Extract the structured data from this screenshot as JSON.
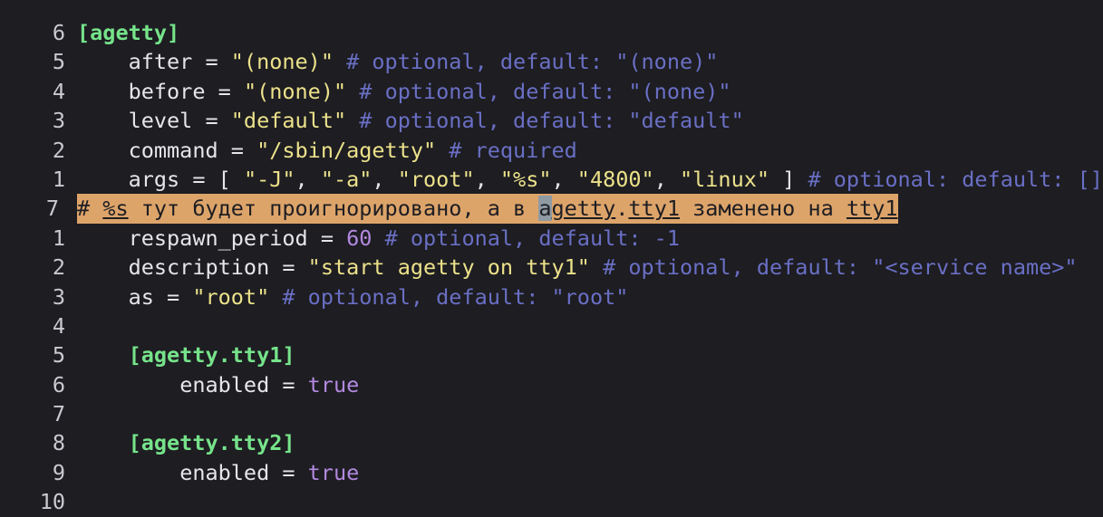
{
  "lines": [
    {
      "num": "6",
      "parts": [
        {
          "t": "sec",
          "v": "[agetty]"
        }
      ]
    },
    {
      "num": "5",
      "indent": "    ",
      "parts": [
        {
          "t": "plain",
          "v": "after = "
        },
        {
          "t": "str",
          "v": "\"(none)\""
        },
        {
          "t": "com",
          "v": " # optional, default: \"(none)\""
        }
      ]
    },
    {
      "num": "4",
      "indent": "    ",
      "parts": [
        {
          "t": "plain",
          "v": "before = "
        },
        {
          "t": "str",
          "v": "\"(none)\""
        },
        {
          "t": "com",
          "v": " # optional, default: \"(none)\""
        }
      ]
    },
    {
      "num": "3",
      "indent": "    ",
      "parts": [
        {
          "t": "plain",
          "v": "level = "
        },
        {
          "t": "str",
          "v": "\"default\""
        },
        {
          "t": "com",
          "v": " # optional, default: \"default\""
        }
      ]
    },
    {
      "num": "2",
      "indent": "    ",
      "parts": [
        {
          "t": "plain",
          "v": "command = "
        },
        {
          "t": "str",
          "v": "\"/sbin/agetty\""
        },
        {
          "t": "com",
          "v": " # required"
        }
      ]
    },
    {
      "num": "1",
      "indent": "    ",
      "parts": [
        {
          "t": "plain",
          "v": "args = [ "
        },
        {
          "t": "str",
          "v": "\"-J\""
        },
        {
          "t": "plain",
          "v": ", "
        },
        {
          "t": "str",
          "v": "\"-a\""
        },
        {
          "t": "plain",
          "v": ", "
        },
        {
          "t": "str",
          "v": "\"root\""
        },
        {
          "t": "plain",
          "v": ", "
        },
        {
          "t": "str",
          "v": "\"%s\""
        },
        {
          "t": "plain",
          "v": ", "
        },
        {
          "t": "str",
          "v": "\"4800\""
        },
        {
          "t": "plain",
          "v": ", "
        },
        {
          "t": "str",
          "v": "\"linux\""
        },
        {
          "t": "plain",
          "v": " ]"
        },
        {
          "t": "com",
          "v": " # optional: default: []"
        }
      ]
    },
    {
      "num": "7",
      "current": true,
      "parts": [
        {
          "t": "plain",
          "v": "# "
        },
        {
          "t": "u",
          "v": "%s"
        },
        {
          "t": "plain",
          "v": " тут будет проигнорировано, а в "
        },
        {
          "t": "cursor",
          "v": "a"
        },
        {
          "t": "u",
          "v": "getty"
        },
        {
          "t": "plain",
          "v": "."
        },
        {
          "t": "u",
          "v": "tty1"
        },
        {
          "t": "plain",
          "v": " заменено на "
        },
        {
          "t": "u",
          "v": "tty1"
        }
      ]
    },
    {
      "num": "1",
      "indent": "    ",
      "parts": [
        {
          "t": "plain",
          "v": "respawn_period = "
        },
        {
          "t": "num",
          "v": "60"
        },
        {
          "t": "com",
          "v": " # optional, default: -1"
        }
      ]
    },
    {
      "num": "2",
      "indent": "    ",
      "parts": [
        {
          "t": "plain",
          "v": "description = "
        },
        {
          "t": "str",
          "v": "\"start agetty on tty1\""
        },
        {
          "t": "com",
          "v": " # optional, default: \"<service name>\""
        }
      ]
    },
    {
      "num": "3",
      "indent": "    ",
      "parts": [
        {
          "t": "plain",
          "v": "as = "
        },
        {
          "t": "str",
          "v": "\"root\""
        },
        {
          "t": "com",
          "v": " # optional, default: \"root\""
        }
      ]
    },
    {
      "num": "4",
      "parts": []
    },
    {
      "num": "5",
      "indent": "    ",
      "parts": [
        {
          "t": "sec",
          "v": "[agetty.tty1]"
        }
      ]
    },
    {
      "num": "6",
      "indent": "        ",
      "parts": [
        {
          "t": "plain",
          "v": "enabled = "
        },
        {
          "t": "bool",
          "v": "true"
        }
      ]
    },
    {
      "num": "7",
      "parts": []
    },
    {
      "num": "8",
      "indent": "    ",
      "parts": [
        {
          "t": "sec",
          "v": "[agetty.tty2]"
        }
      ]
    },
    {
      "num": "9",
      "indent": "        ",
      "parts": [
        {
          "t": "plain",
          "v": "enabled = "
        },
        {
          "t": "bool",
          "v": "true"
        }
      ]
    },
    {
      "num": "10",
      "parts": []
    }
  ]
}
